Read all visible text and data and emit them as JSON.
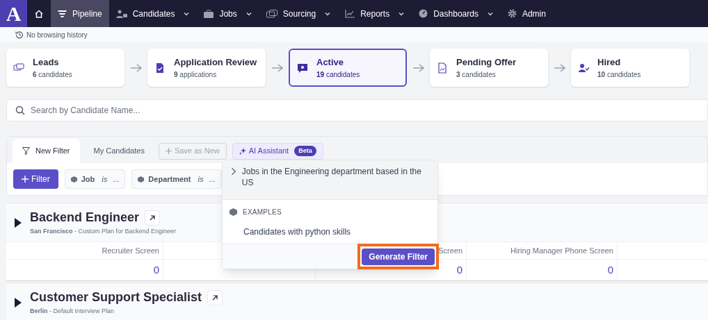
{
  "nav": {
    "logo": "A",
    "items": [
      {
        "selected": false,
        "dropdown": false
      },
      {
        "label": "Pipeline",
        "selected": true,
        "dropdown": false
      },
      {
        "label": "Candidates",
        "selected": false,
        "dropdown": true
      },
      {
        "label": "Jobs",
        "selected": false,
        "dropdown": true
      },
      {
        "label": "Sourcing",
        "selected": false,
        "dropdown": true
      },
      {
        "label": "Reports",
        "selected": false,
        "dropdown": true
      },
      {
        "label": "Dashboards",
        "selected": false,
        "dropdown": true
      },
      {
        "label": "Admin",
        "selected": false,
        "dropdown": false
      }
    ]
  },
  "history": "No browsing history",
  "stages": [
    {
      "title": "Leads",
      "count": "6",
      "unit": "candidates",
      "selected": false
    },
    {
      "title": "Application Review",
      "count": "9",
      "unit": "applications",
      "selected": false
    },
    {
      "title": "Active",
      "count": "19",
      "unit": "candidates",
      "selected": true
    },
    {
      "title": "Pending Offer",
      "count": "3",
      "unit": "candidates",
      "selected": false
    },
    {
      "title": "Hired",
      "count": "10",
      "unit": "candidates",
      "selected": false
    }
  ],
  "search": {
    "placeholder": "Search by Candidate Name..."
  },
  "filter_tabs": [
    {
      "label": "New Filter",
      "selected": true
    },
    {
      "label": "My Candidates",
      "selected": false
    }
  ],
  "save_button": "Save as New",
  "ai_button": {
    "label": "AI Assistant",
    "badge": "Beta"
  },
  "filter_button": "Filter",
  "chips": [
    {
      "field": "Job",
      "operator": "is",
      "value": "..."
    },
    {
      "field": "Department",
      "operator": "is",
      "value": "..."
    }
  ],
  "jobs": [
    {
      "title": "Backend Engineer",
      "subtitle": "**San Francisco** - Custom Plan for Backend Engineer",
      "columns": [
        {
          "header": "Recruiter Screen",
          "value": "0"
        },
        {
          "header": "Screen",
          "value": "0"
        },
        {
          "header": "Hiring Manager Phone Screen",
          "value": "0"
        }
      ]
    },
    {
      "title": "Customer Support Specialist",
      "subtitle": "**Berlin** - Default Interview Plan"
    }
  ],
  "ai_popup": {
    "suggestion": "Jobs in the Engineering department based in the US",
    "examples_heading": "EXAMPLES",
    "examples": [
      "Candidates with python skills"
    ],
    "button": "Generate Filter"
  }
}
